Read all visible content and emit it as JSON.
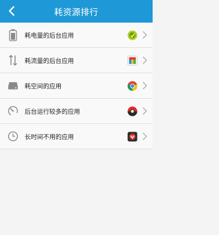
{
  "header": {
    "title": "耗资源排行"
  },
  "rows": [
    {
      "label": "耗电量的后台应用",
      "row_icon": "battery-icon",
      "app_icon": "green-leaf-app-icon"
    },
    {
      "label": "耗流量的后台应用",
      "row_icon": "transfer-arrows-icon",
      "app_icon": "colorful-app-icon"
    },
    {
      "label": "耗空间的应用",
      "row_icon": "storage-drive-icon",
      "app_icon": "chrome-icon"
    },
    {
      "label": "后台运行较多的应用",
      "row_icon": "speedometer-icon",
      "app_icon": "red-app-icon"
    },
    {
      "label": "长时间不用的应用",
      "row_icon": "clock-icon",
      "app_icon": "dark-app-icon"
    }
  ],
  "colors": {
    "header_bg": "#1e98d6",
    "row_bg": "#f9f9f9",
    "divider": "#e1e1e1"
  }
}
